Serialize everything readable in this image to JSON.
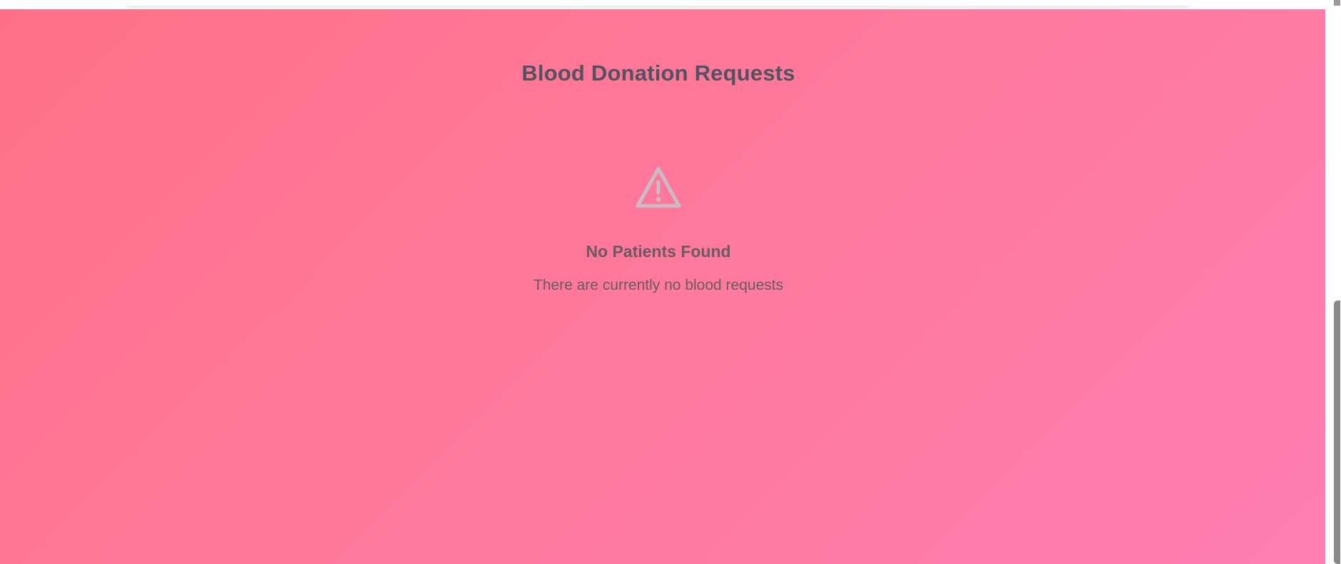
{
  "page": {
    "title": "Blood Donation Requests"
  },
  "empty_state": {
    "icon": "warning-triangle-icon",
    "title": "No Patients Found",
    "message": "There are currently no blood requests"
  },
  "colors": {
    "gradient_start": "#ff7088",
    "gradient_end": "#ff7fb2",
    "title_text": "#525260",
    "muted_text": "#6a5a62",
    "icon": "#c9bcc4"
  }
}
